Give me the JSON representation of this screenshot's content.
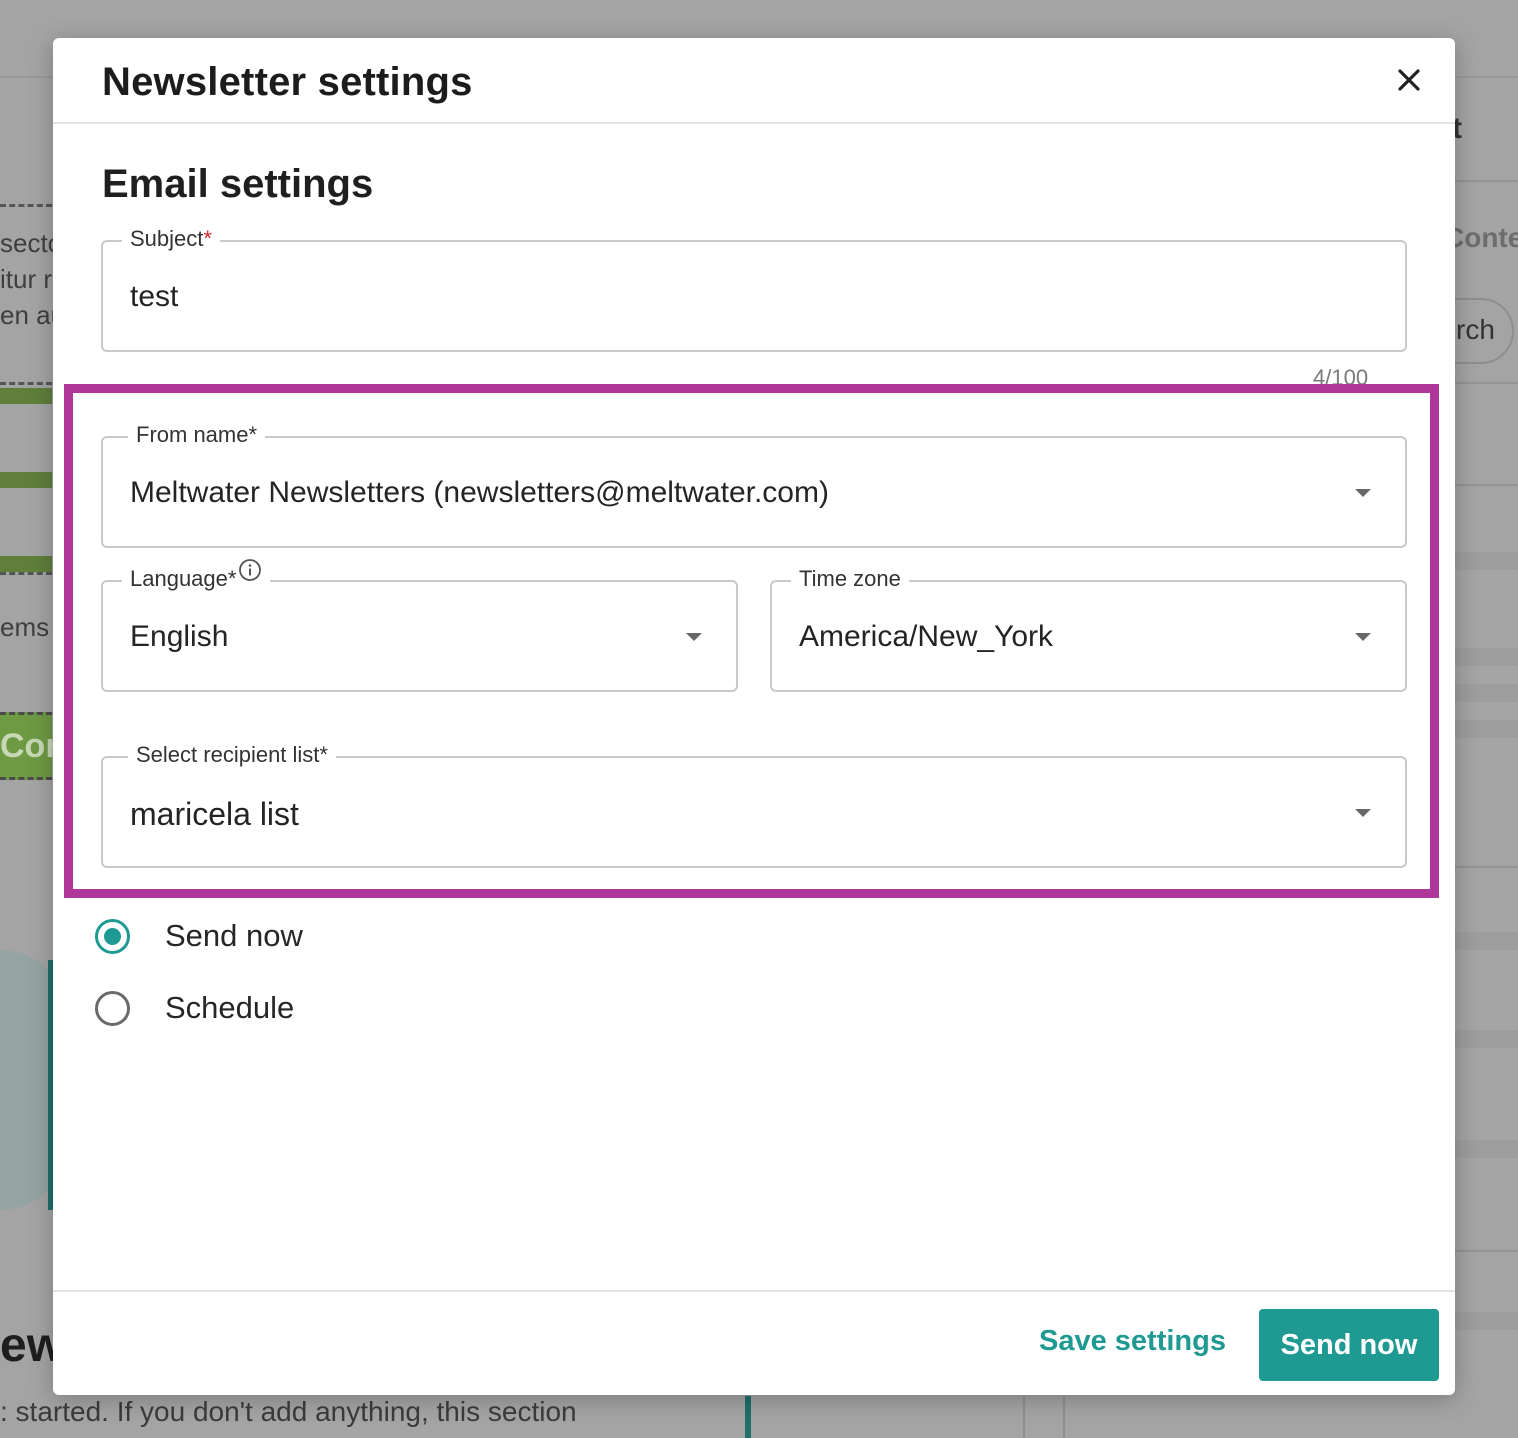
{
  "background": {
    "left_fragments": [
      "secto",
      "itur r",
      "en au",
      "ems"
    ],
    "tab_fragment": "Corp",
    "heading_fragment": "ew",
    "bottom_text": ": started. If you don't add anything, this section",
    "right_fragment_t": "t",
    "right_fragment_content": "Conte",
    "right_fragment_search": "rch"
  },
  "modal": {
    "title": "Newsletter settings",
    "close_icon": "close-icon",
    "section_title": "Email settings",
    "subject": {
      "label": "Subject",
      "required_mark": "*",
      "value": "test",
      "counter": "4/100"
    },
    "from_name": {
      "label": "From name*",
      "value": "Meltwater Newsletters (newsletters@meltwater.com)"
    },
    "language": {
      "label": "Language*",
      "value": "English",
      "info_icon": "info-icon"
    },
    "time_zone": {
      "label": "Time zone",
      "value": "America/New_York"
    },
    "recipient_list": {
      "label": "Select recipient list*",
      "value": "maricela list"
    },
    "send_options": [
      {
        "label": "Send now",
        "checked": true
      },
      {
        "label": "Schedule",
        "checked": false
      }
    ],
    "footer": {
      "save_label": "Save settings",
      "send_label": "Send now"
    }
  },
  "colors": {
    "accent": "#1f9a93",
    "highlight": "#b0379a",
    "required": "#d4272a"
  }
}
